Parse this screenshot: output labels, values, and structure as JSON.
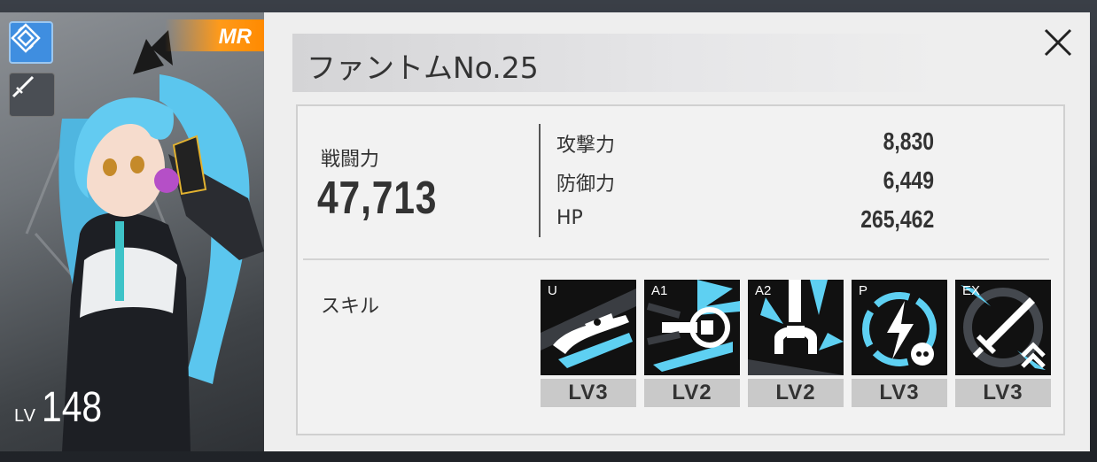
{
  "character": {
    "rank": "MR",
    "level_label": "LV",
    "level": "148",
    "class_icon": "diamond-emblem-icon",
    "weapon_icon": "sword-icon"
  },
  "panel": {
    "title": "ファントムNo.25",
    "close_icon": "close-icon",
    "combat_power_label": "戦闘力",
    "combat_power": "47,713",
    "stats": [
      {
        "name": "攻撃力",
        "value": "8,830"
      },
      {
        "name": "防御力",
        "value": "6,449"
      },
      {
        "name": "HP",
        "value": "265,462"
      }
    ],
    "skills_label": "スキル",
    "skills": [
      {
        "code": "U",
        "level": "LV3",
        "icon": "claw-strike-icon"
      },
      {
        "code": "A1",
        "level": "LV2",
        "icon": "mechanical-claw-icon"
      },
      {
        "code": "A2",
        "level": "LV2",
        "icon": "grabber-claw-icon"
      },
      {
        "code": "P",
        "level": "LV3",
        "icon": "lightning-skull-icon"
      },
      {
        "code": "EX",
        "level": "LV3",
        "icon": "sword-rank-up-icon"
      }
    ]
  },
  "colors": {
    "accent_cyan": "#5ed0f2",
    "rank_orange": "#ff9a1a",
    "class_blue": "#3f8ee0"
  }
}
